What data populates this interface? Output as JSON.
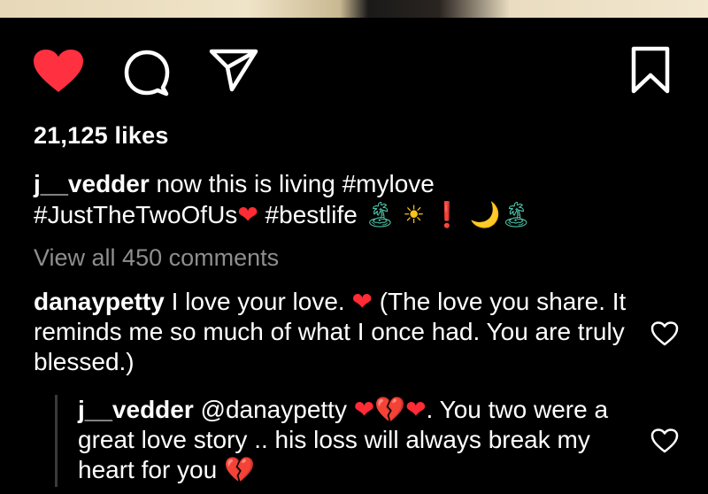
{
  "post": {
    "likes": "21,125 likes",
    "caption": {
      "username": "j__vedder",
      "text_line1": " now this is living #mylove",
      "text_line2": "#JustTheTwoOfUs",
      "heart": "❤",
      "text_line2b": " #bestlife ",
      "emoji_island1": "🏝",
      "emoji_sun": "☀",
      "emoji_exclaim": "❗",
      "emoji_moon": "🌙",
      "emoji_island2": "🏝"
    },
    "view_all": "View all 450 comments"
  },
  "comment": {
    "username": "danaypetty",
    "text1": " I love your love. ",
    "heart": "❤",
    "text2": " (The love you share. It reminds me so much of what I once had. You are truly blessed.)"
  },
  "reply": {
    "username": "j__vedder",
    "mention": " @danaypetty ",
    "heart1": "❤",
    "broken": "💔",
    "heart2": "❤",
    "text": ". You two were a great love story .. his loss will always break my heart for you ",
    "broken_end": "💔"
  },
  "icons": {
    "like": "heart-filled-icon",
    "comment": "comment-bubble-icon",
    "share": "paper-plane-icon",
    "save": "bookmark-icon",
    "comment_like": "heart-outline-icon"
  },
  "colors": {
    "like": "#ff3040",
    "muted": "#8e8e8e"
  }
}
